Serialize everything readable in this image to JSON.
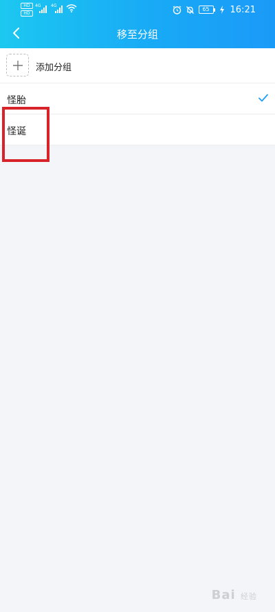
{
  "status_bar": {
    "network_left": "4G",
    "network_right": "4G",
    "hd1": "HD",
    "hd2": "HD",
    "battery": "65",
    "time": "16:21"
  },
  "header": {
    "title": "移至分组"
  },
  "list": {
    "add_label": "添加分组",
    "groups": [
      {
        "label": "怪胎",
        "selected": true
      },
      {
        "label": "怪诞",
        "selected": false
      }
    ]
  },
  "watermark": {
    "brand": "Bai",
    "suffix": "经验"
  },
  "colors": {
    "header_start": "#1cc8f0",
    "header_end": "#1a9af8",
    "check": "#1e9ef5",
    "highlight": "#d8232a",
    "background": "#f4f5f9"
  }
}
